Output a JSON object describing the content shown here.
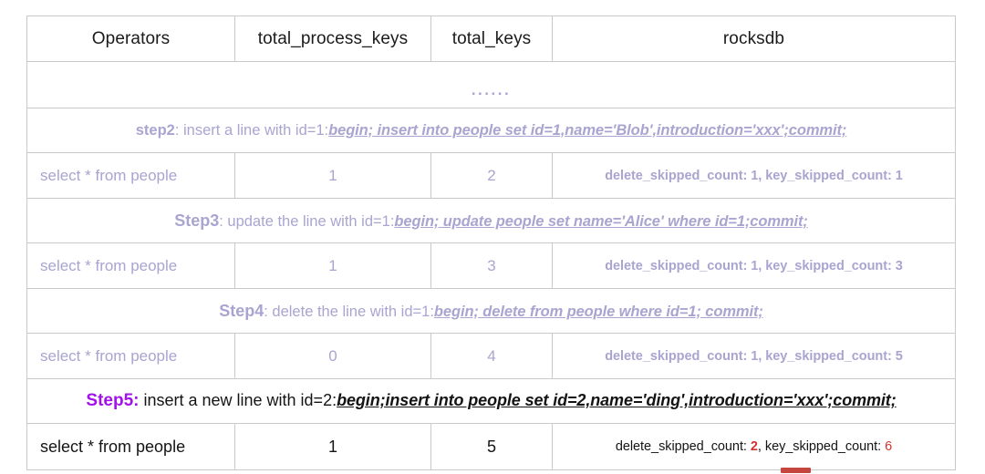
{
  "table": {
    "columns": [
      "Operators",
      "total_process_keys",
      "total_keys",
      "rocksdb"
    ],
    "ellipsis": "......",
    "rows": [
      {
        "kind": "step",
        "label": "step2",
        "text": ": insert a line with id=1:",
        "sql": "begin; insert into people set id=1,name='Blob',introduction='xxx';commit;"
      },
      {
        "kind": "data",
        "operator": "select * from people",
        "total_process_keys": "1",
        "total_keys": "2",
        "rocksdb_prefix": "delete_skipped_count: ",
        "rocksdb_value1": "1",
        "rocksdb_middle": ", key_skipped_count: ",
        "rocksdb_value2": "1"
      },
      {
        "kind": "step",
        "label": "Step3",
        "text": ": update the line with id=1:",
        "sql": "begin; update people set name='Alice' where id=1;commit;"
      },
      {
        "kind": "data",
        "operator": "select * from people",
        "total_process_keys": "1",
        "total_keys": "3",
        "rocksdb_prefix": "delete_skipped_count: ",
        "rocksdb_value1": "1",
        "rocksdb_middle": ", key_skipped_count: ",
        "rocksdb_value2": "3"
      },
      {
        "kind": "step",
        "label": "Step4",
        "text": ": delete the line with id=1:",
        "sql": "begin; delete from people where id=1; commit;"
      },
      {
        "kind": "data",
        "operator": "select * from people",
        "total_process_keys": "0",
        "total_keys": "4",
        "rocksdb_prefix": "delete_skipped_count: ",
        "rocksdb_value1": "1",
        "rocksdb_middle": ", key_skipped_count: ",
        "rocksdb_value2": "5"
      },
      {
        "kind": "step",
        "label": "Step5:",
        "text": " insert a new line with id=2:",
        "sql": "begin;insert into people set id=2,name='ding',introduction='xxx';commit;"
      },
      {
        "kind": "data",
        "operator": "select * from people",
        "total_process_keys": "1",
        "total_keys": "5",
        "rocksdb_prefix": "delete_skipped_count: ",
        "rocksdb_value1": "2",
        "rocksdb_middle": ", key_skipped_count: ",
        "rocksdb_value2": "6"
      }
    ]
  },
  "colors": {
    "muted_purple": "#a9a4d0",
    "highlight_magenta": "#a112ea",
    "accent_red": "#d0342c",
    "text_black": "#141414",
    "border": "#c9c9c9"
  }
}
